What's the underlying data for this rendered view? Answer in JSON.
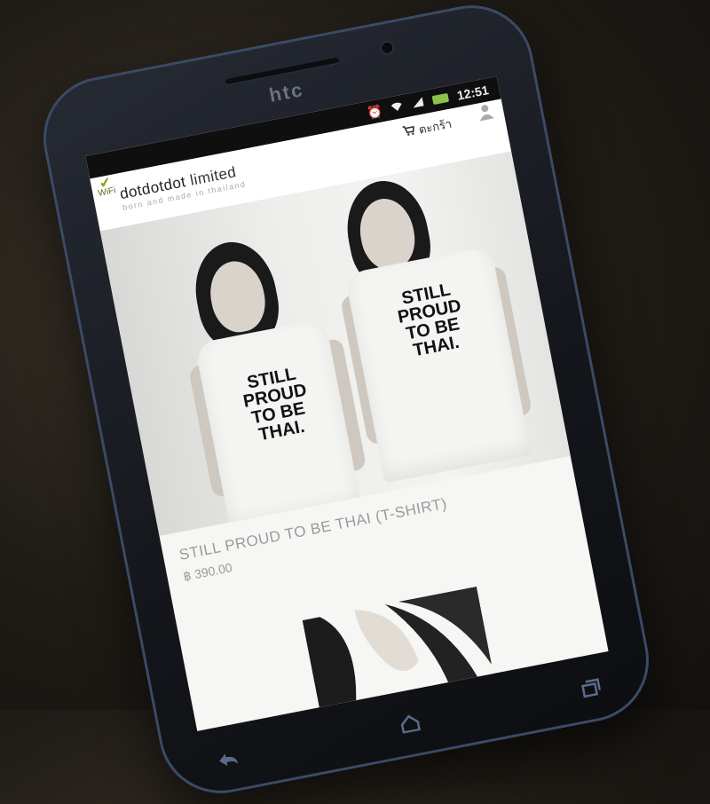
{
  "device": {
    "brand": "htc"
  },
  "status_bar": {
    "time": "12:51",
    "icons": [
      "alarm-icon",
      "wifi-icon",
      "signal-icon",
      "battery-icon"
    ]
  },
  "site": {
    "title_prefix": "dotdotdot",
    "title_suffix": "limited",
    "tagline": "born and made in thailand",
    "wifi_badge": "WiFi",
    "cart_label": "ตะกร้า"
  },
  "hero": {
    "shirt_text_left": [
      "STILL",
      "PROUD",
      "TO BE",
      "THAI."
    ],
    "shirt_text_right": [
      "STILL",
      "PROUD",
      "TO BE",
      "THAI."
    ]
  },
  "product": {
    "name": "STILL PROUD TO BE THAI (T-SHIRT)",
    "price": "฿ 390.00"
  },
  "nav": {
    "icons": [
      "home-icon",
      "recent-apps-icon"
    ]
  }
}
